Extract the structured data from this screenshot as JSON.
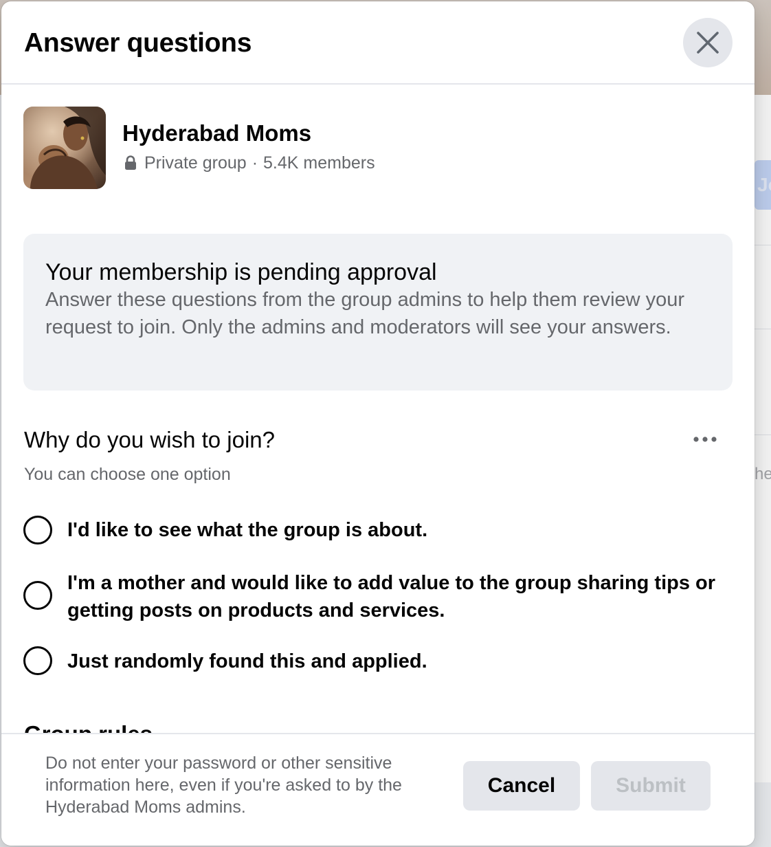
{
  "background": {
    "join_peek": "Jo",
    "text_peek": "he"
  },
  "dialog": {
    "title": "Answer questions",
    "close_icon": "close-icon"
  },
  "group": {
    "name": "Hyderabad Moms",
    "privacy": "Private group",
    "separator": "·",
    "members": "5.4K members",
    "privacy_icon": "lock-icon"
  },
  "notice": {
    "title": "Your membership is pending approval",
    "text": "Answer these questions from the group admins to help them review your request to join. Only the admins and moderators will see your answers."
  },
  "question": {
    "title": "Why do you wish to join?",
    "hint": "You can choose one option",
    "more_icon": "more-dots-icon",
    "options": [
      {
        "label": "I'd like to see what the group is about.",
        "selected": false
      },
      {
        "label": "I'm a mother and would like to add value to the group sharing tips or getting posts on products and services.",
        "selected": false
      },
      {
        "label": "Just randomly found this and applied.",
        "selected": false
      }
    ]
  },
  "next_section": {
    "title": "Group rules"
  },
  "footer": {
    "warning": "Do not enter your password or other sensitive information here, even if you're asked to by the Hyderabad Moms admins.",
    "cancel_label": "Cancel",
    "submit_label": "Submit",
    "submit_enabled": false
  },
  "colors": {
    "text_primary": "#050505",
    "text_secondary": "#65676b",
    "surface_gray": "#f0f2f5",
    "button_gray": "#e4e6eb",
    "disabled_text": "#bcc0c4"
  }
}
